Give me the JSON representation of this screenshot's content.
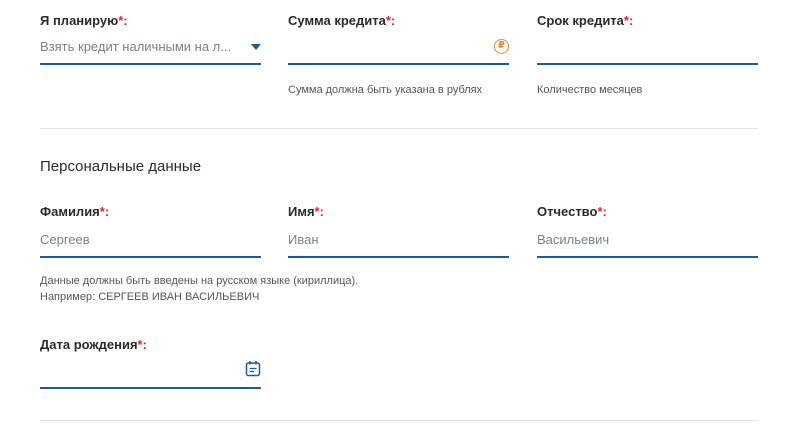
{
  "loan": {
    "purpose": {
      "label": "Я планирую",
      "required": "*:",
      "value": "Взять кредит наличными на л..."
    },
    "amount": {
      "label": "Сумма кредита",
      "required": "*:",
      "value": "",
      "currency_symbol": "₽",
      "hint": "Сумма должна быть указана в рублях"
    },
    "term": {
      "label": "Срок кредита",
      "required": "*:",
      "value": "",
      "hint": "Количество месяцев"
    }
  },
  "personal": {
    "title": "Персональные данные",
    "last_name": {
      "label": "Фамилия",
      "required": "*:",
      "placeholder": "Сергеев"
    },
    "first_name": {
      "label": "Имя",
      "required": "*:",
      "placeholder": "Иван"
    },
    "middle_name": {
      "label": "Отчество",
      "required": "*:",
      "placeholder": "Васильевич"
    },
    "hint_line1": "Данные должны быть введены на русском языке (кириллица).",
    "hint_line2": "Например: СЕРГЕЕВ ИВАН ВАСИЛЬЕВИЧ",
    "birth_date": {
      "label": "Дата рождения",
      "required": "*:",
      "value": ""
    }
  },
  "colors": {
    "accent": "#1f5a93",
    "required": "#d9262e",
    "currency": "#e8893a"
  },
  "icons": {
    "dropdown": "chevron-down-icon",
    "currency": "ruble-icon",
    "calendar": "calendar-icon"
  }
}
